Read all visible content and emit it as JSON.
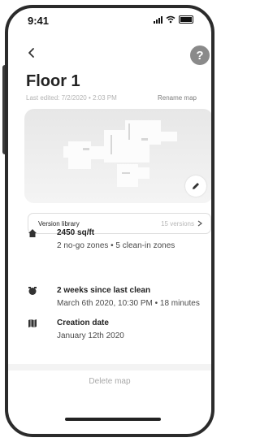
{
  "status_bar": {
    "time": "9:41"
  },
  "header": {
    "title": "Floor 1",
    "subtitle": "Last edited: 7/2/2020 • 2:03 PM",
    "rename": "Rename map",
    "help": "?"
  },
  "version": {
    "label": "Version library",
    "count": "15 versions"
  },
  "info": [
    {
      "icon": "home-icon",
      "title": "2450 sq/ft",
      "detail": "2 no-go zones • 5 clean-in zones"
    },
    {
      "icon": "robot-icon",
      "title": "2 weeks since last clean",
      "detail": "March 6th 2020, 10:30 PM • 18 minutes"
    },
    {
      "icon": "map-icon",
      "title": "Creation date",
      "detail": "January 12th 2020"
    }
  ],
  "footer": {
    "delete": "Delete map"
  }
}
